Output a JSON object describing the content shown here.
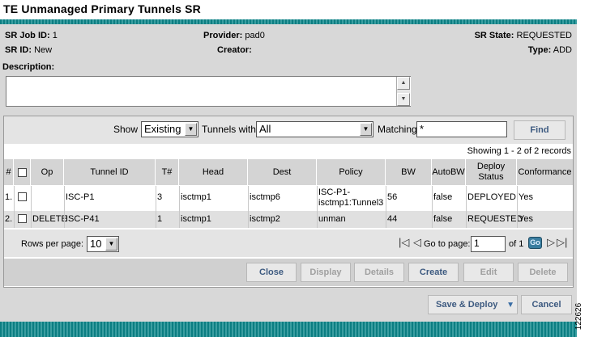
{
  "page_title": "TE Unmanaged Primary Tunnels SR",
  "info": {
    "sr_job_id_label": "SR Job ID:",
    "sr_job_id": "1",
    "provider_label": "Provider:",
    "provider": "pad0",
    "sr_state_label": "SR State:",
    "sr_state": "REQUESTED",
    "sr_id_label": "SR ID:",
    "sr_id": "New",
    "creator_label": "Creator:",
    "creator": "",
    "type_label": "Type:",
    "type": "ADD"
  },
  "description": {
    "label": "Description:",
    "value": ""
  },
  "filter": {
    "show_label": "Show",
    "show_value": "Existing",
    "tunnels_with_label": "Tunnels with",
    "tunnels_with_value": "All",
    "matching_label": "Matching",
    "matching_value": "*",
    "find_label": "Find"
  },
  "showing_text": "Showing 1 - 2 of 2 records",
  "table": {
    "headers": {
      "num": "#",
      "op": "Op",
      "tunnel_id": "Tunnel ID",
      "tnum": "T#",
      "head": "Head",
      "dest": "Dest",
      "policy": "Policy",
      "bw": "BW",
      "autobw": "AutoBW",
      "deploy_status_1": "Deploy",
      "deploy_status_2": "Status",
      "conformance": "Conformance"
    },
    "rows": [
      {
        "num": "1.",
        "op": "",
        "tunnel_id": "ISC-P1",
        "tnum": "3",
        "head": "isctmp1",
        "dest": "isctmp6",
        "policy_1": "ISC-P1-",
        "policy_2": "isctmp1:Tunnel3",
        "bw": "56",
        "autobw": "false",
        "deploy_status": "DEPLOYED",
        "conformance": "Yes"
      },
      {
        "num": "2.",
        "op": "DELETE",
        "tunnel_id": "ISC-P41",
        "tnum": "1",
        "head": "isctmp1",
        "dest": "isctmp2",
        "policy": "unman",
        "bw": "44",
        "autobw": "false",
        "deploy_status": "REQUESTED",
        "conformance": "Yes"
      }
    ]
  },
  "pagination": {
    "rows_per_page_label": "Rows per page:",
    "rows_per_page_value": "10",
    "go_to_page_label": "Go to page:",
    "page_value": "1",
    "of_label": "of 1",
    "go_label": "Go"
  },
  "grid_buttons": {
    "close": "Close",
    "display": "Display",
    "details": "Details",
    "create": "Create",
    "edit": "Edit",
    "delete": "Delete"
  },
  "actions": {
    "save_deploy": "Save & Deploy",
    "cancel": "Cancel"
  },
  "figure_number": "122626"
}
